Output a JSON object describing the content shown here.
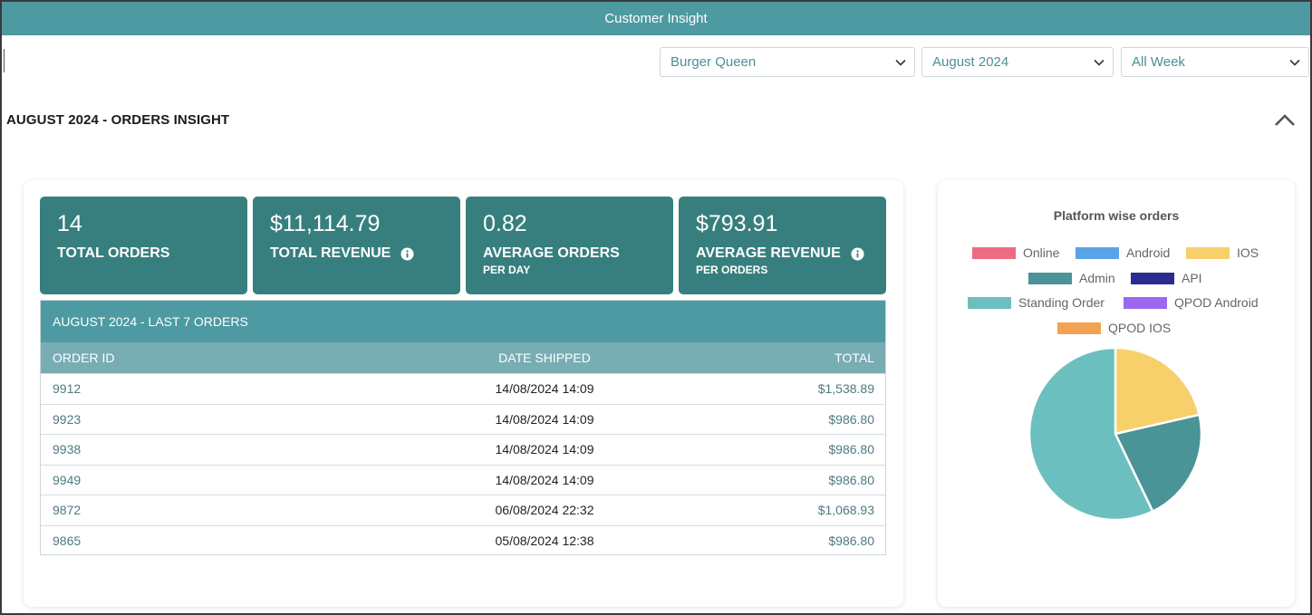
{
  "header": {
    "title": "Customer Insight"
  },
  "filters": {
    "store": "Burger Queen",
    "month": "August 2024",
    "week": "All Week"
  },
  "section": {
    "title": "AUGUST 2024 - ORDERS INSIGHT"
  },
  "stats": [
    {
      "value": "14",
      "label": "TOTAL ORDERS",
      "sub": ""
    },
    {
      "value": "$11,114.79",
      "label": "TOTAL REVENUE",
      "sub": ""
    },
    {
      "value": "0.82",
      "label": "AVERAGE ORDERS",
      "sub": "PER DAY"
    },
    {
      "value": "$793.91",
      "label": "AVERAGE REVENUE",
      "sub": "PER ORDERS"
    }
  ],
  "orders_table": {
    "title": "AUGUST 2024 - LAST 7 ORDERS",
    "columns": [
      "ORDER ID",
      "DATE SHIPPED",
      "TOTAL"
    ],
    "rows": [
      {
        "id": "9912",
        "date": "14/08/2024 14:09",
        "total": "$1,538.89"
      },
      {
        "id": "9923",
        "date": "14/08/2024 14:09",
        "total": "$986.80"
      },
      {
        "id": "9938",
        "date": "14/08/2024 14:09",
        "total": "$986.80"
      },
      {
        "id": "9949",
        "date": "14/08/2024 14:09",
        "total": "$986.80"
      },
      {
        "id": "9872",
        "date": "06/08/2024 22:32",
        "total": "$1,068.93"
      },
      {
        "id": "9865",
        "date": "05/08/2024 12:38",
        "total": "$986.80"
      }
    ]
  },
  "chart": {
    "title": "Platform wise orders",
    "legend": [
      {
        "name": "Online",
        "color": "#ee6b84"
      },
      {
        "name": "Android",
        "color": "#5aa3e6"
      },
      {
        "name": "IOS",
        "color": "#f7cf6b"
      },
      {
        "name": "Admin",
        "color": "#4a9396"
      },
      {
        "name": "API",
        "color": "#2b2d8e"
      },
      {
        "name": "Standing Order",
        "color": "#6cbfbf"
      },
      {
        "name": "QPOD Android",
        "color": "#9b68f0"
      },
      {
        "name": "QPOD IOS",
        "color": "#f2a352"
      }
    ]
  },
  "chart_data": {
    "type": "pie",
    "title": "Platform wise orders",
    "labels": [
      "Online",
      "Android",
      "IOS",
      "Admin",
      "API",
      "Standing Order",
      "QPOD Android",
      "QPOD IOS"
    ],
    "values": [
      0,
      0,
      3,
      3,
      0,
      8,
      0,
      0
    ],
    "colors": [
      "#ee6b84",
      "#5aa3e6",
      "#f7cf6b",
      "#4a9396",
      "#2b2d8e",
      "#6cbfbf",
      "#9b68f0",
      "#f2a352"
    ],
    "legend_position": "top"
  }
}
